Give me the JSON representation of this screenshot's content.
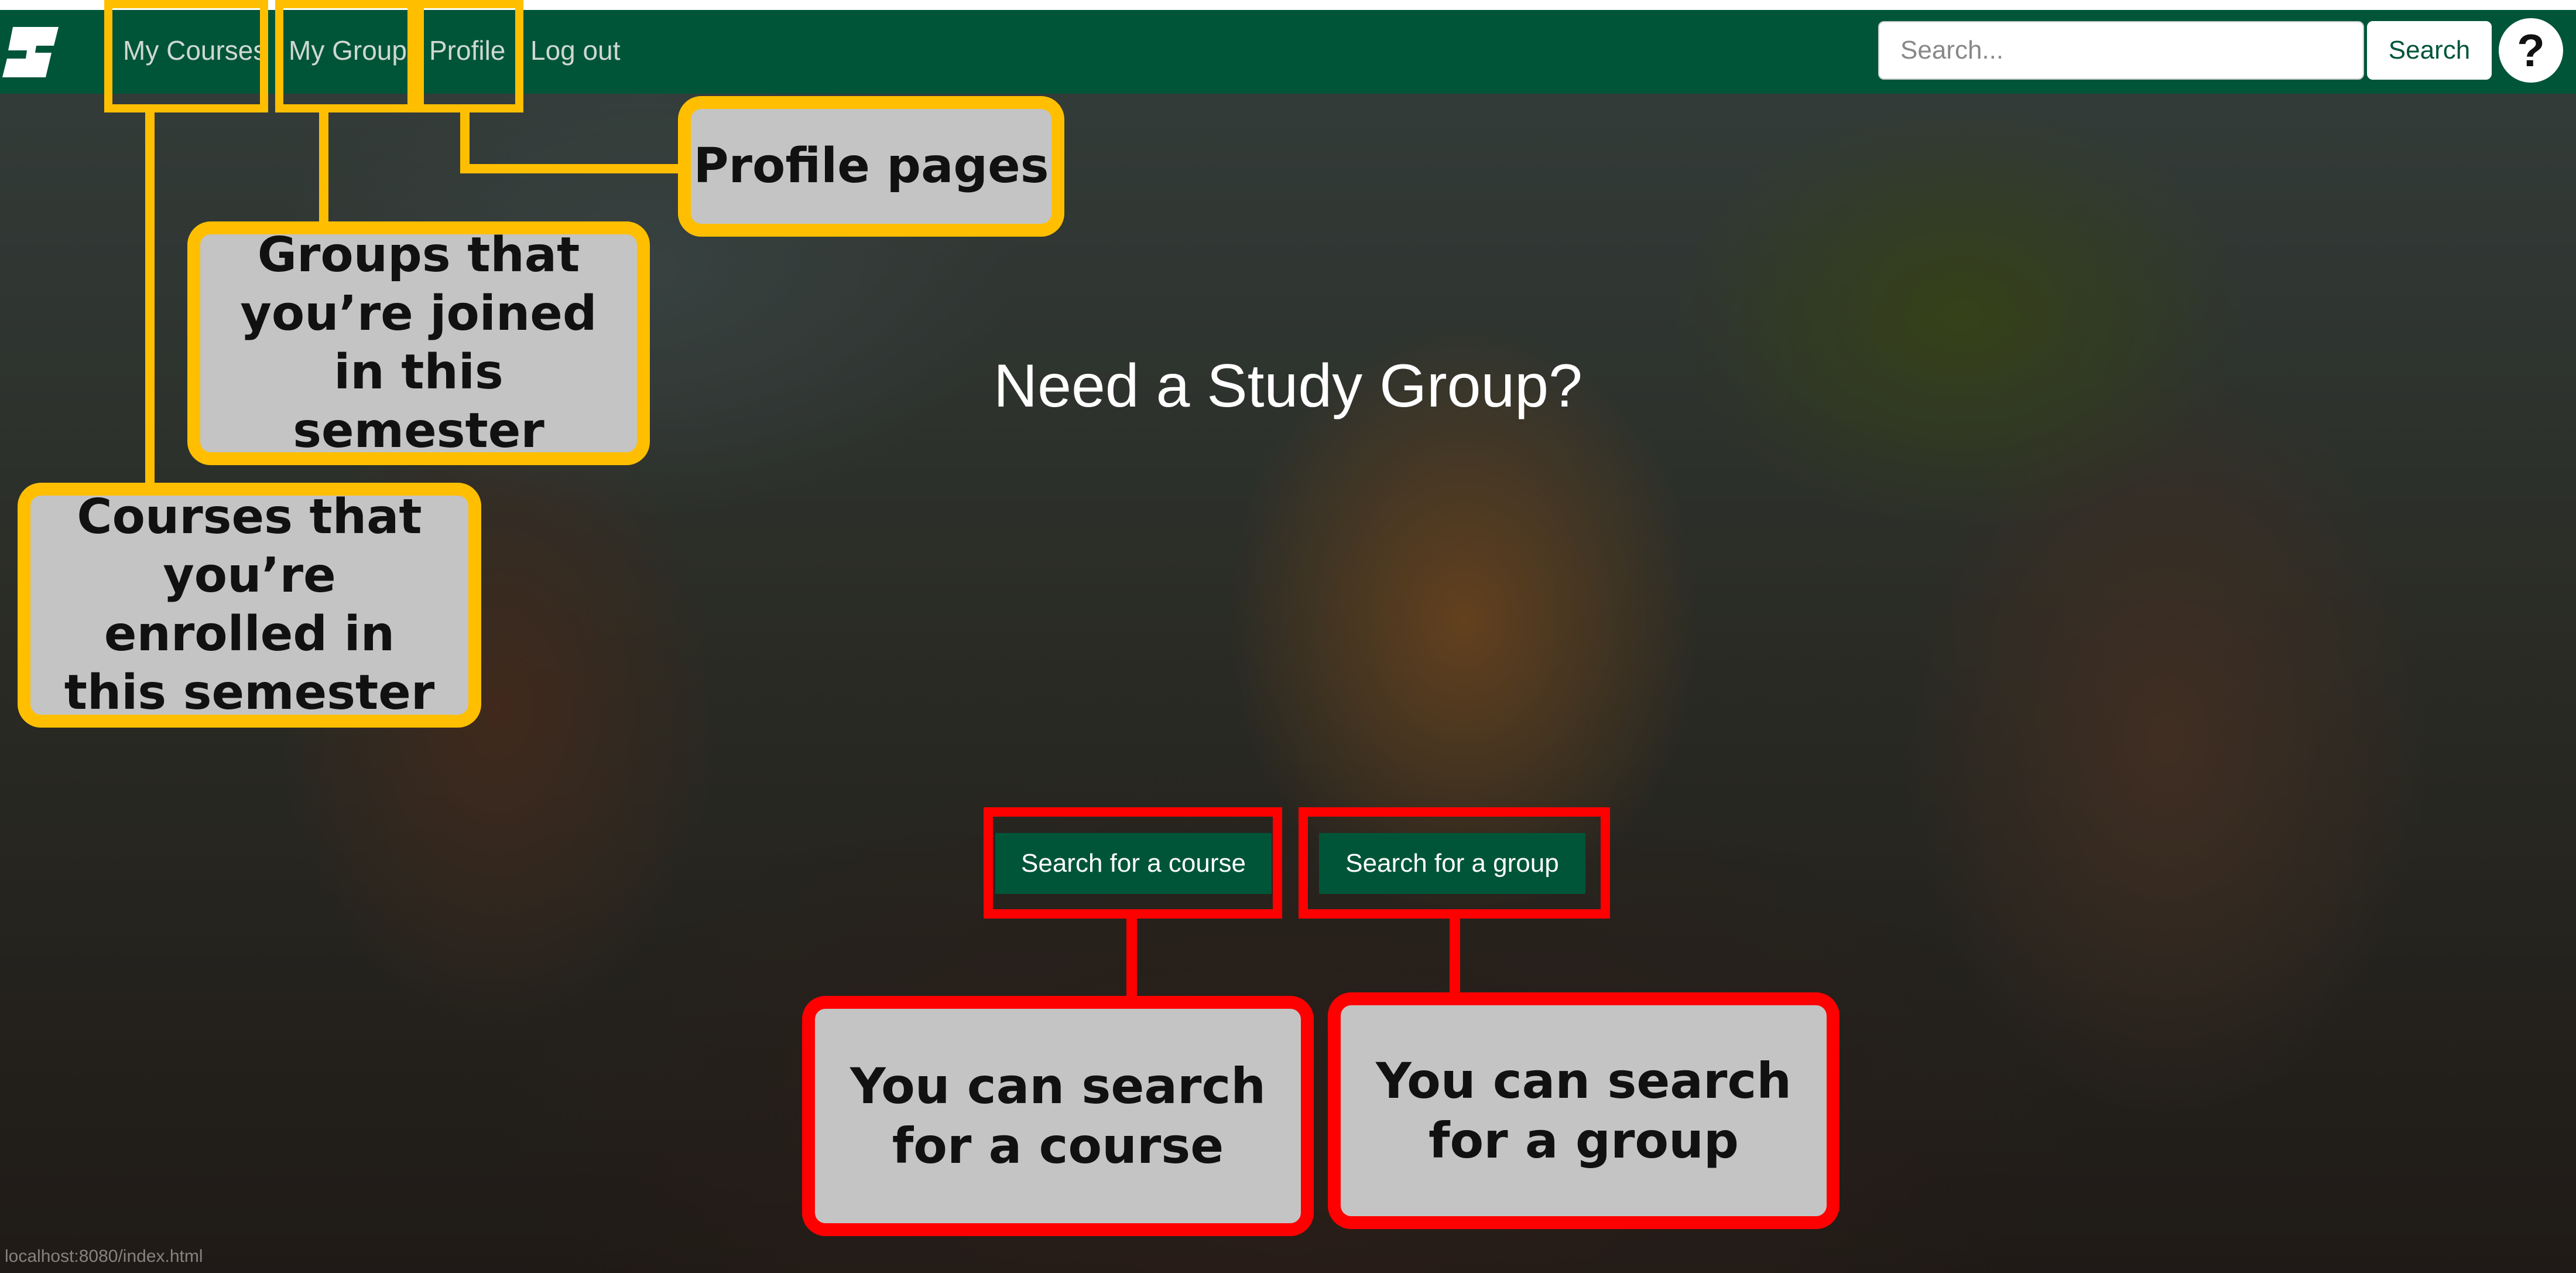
{
  "nav": {
    "logo": "university-logo",
    "links": [
      "My Courses",
      "My Group",
      "Profile",
      "Log out"
    ],
    "search": {
      "placeholder": "Search...",
      "value": "",
      "button_label": "Search"
    },
    "help_label": "?"
  },
  "hero": {
    "title": "Need a Study Group?",
    "buttons": [
      "Search for a course",
      "Search for a group"
    ]
  },
  "annotations": {
    "profile": "Profile pages",
    "groups": "Groups that you’re joined in this semester",
    "courses": "Courses that you’re enrolled in this semester",
    "search_course": "You can search for a course",
    "search_group": "You can search for a group"
  },
  "status_bar": {
    "url": "localhost:8080/index.html"
  },
  "colors": {
    "brand_green": "#005538",
    "highlight_yellow": "#ffbf00",
    "highlight_red": "#ff0000",
    "callout_fill": "#c4c4c4"
  }
}
